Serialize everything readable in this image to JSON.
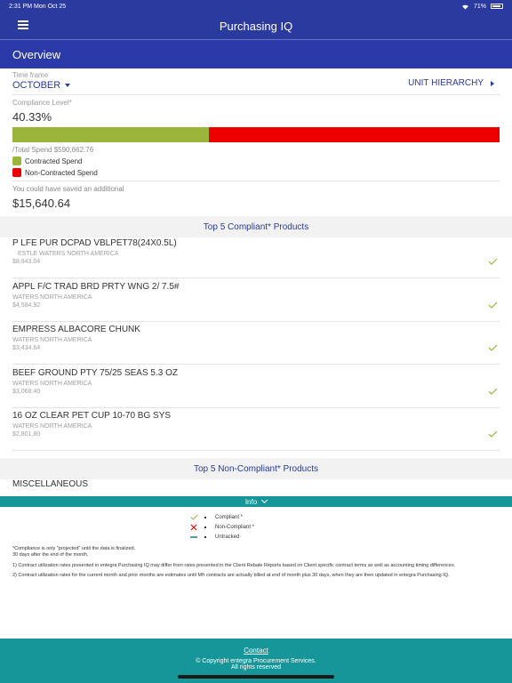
{
  "status": {
    "time": "2:31 PM  Mon Oct 25",
    "battery": "71%"
  },
  "nav": {
    "title": "Purchasing IQ"
  },
  "overview": {
    "title": "Overview"
  },
  "timeframe": {
    "label": "Time frame",
    "value": "OCTOBER"
  },
  "unit_hierarchy": {
    "label": "UNIT HIERARCHY"
  },
  "compliance": {
    "label": "Compliance Level*",
    "value": "40.33%",
    "compliant_fraction": 0.4033,
    "total_spend": "/Total Spend $590,662.76",
    "legend": [
      {
        "label": "Contracted Spend",
        "color": "#9ab53a"
      },
      {
        "label": "Non-Contracted Spend",
        "color": "#ee0000"
      }
    ],
    "saved_label": "You could have saved an additional",
    "saved_value": "$15,640.64"
  },
  "top_compliant": {
    "title": "Top 5 Compliant* Products",
    "items": [
      {
        "name": "P LFE PUR DCPAD VBLPET78(24X0.5L)",
        "mfr": "ESTLE WATERS NORTH AMERICA",
        "spend": "$8,943.04"
      },
      {
        "name": "APPL F/C TRAD BRD PRTY WNG 2/ 7.5#",
        "mfr": "WATERS NORTH AMERICA",
        "spend": "$4,584.92"
      },
      {
        "name": "EMPRESS ALBACORE CHUNK",
        "mfr": "WATERS NORTH AMERICA",
        "spend": "$3,434.64"
      },
      {
        "name": "BEEF GROUND PTY 75/25 SEAS 5.3 OZ",
        "mfr": "WATERS NORTH AMERICA",
        "spend": "$3,068.40"
      },
      {
        "name": "16 OZ CLEAR PET CUP 10-70 BG SYS",
        "mfr": "WATERS NORTH AMERICA",
        "spend": "$2,801.80"
      }
    ]
  },
  "top_noncompliant": {
    "title": "Top 5 Non-Compliant* Products",
    "first_item": "MISCELLANEOUS"
  },
  "info": {
    "label": "Info",
    "legend": [
      {
        "label": "Compliant *"
      },
      {
        "label": "Non-Compliant *"
      },
      {
        "label": "Untracked"
      }
    ],
    "notes": [
      "*Compliance is only \"projected\" until the data is finalized, 30 days after the end of the month.",
      "1)      Contract utilization rates presented in entegra Purchasing IQ may differ from rates presented in the Client Rebate Reports based on Client specific contract terms as well as accounting timing differences.",
      "2)      Contract utilization rates for the current month and prior months are estimates until Mfr contracts are actually billed at end of month plus 30 days, when they are then updated in entegra Purchasing IQ."
    ]
  },
  "footer": {
    "contact": "Contact",
    "copyright": "© Copyright entegra Procurement Services.",
    "rights": "All rights reserved"
  },
  "colors": {
    "primary": "#2b3a9e",
    "teal": "#17969a",
    "compliant": "#9ab53a",
    "noncompliant": "#ee0000"
  }
}
